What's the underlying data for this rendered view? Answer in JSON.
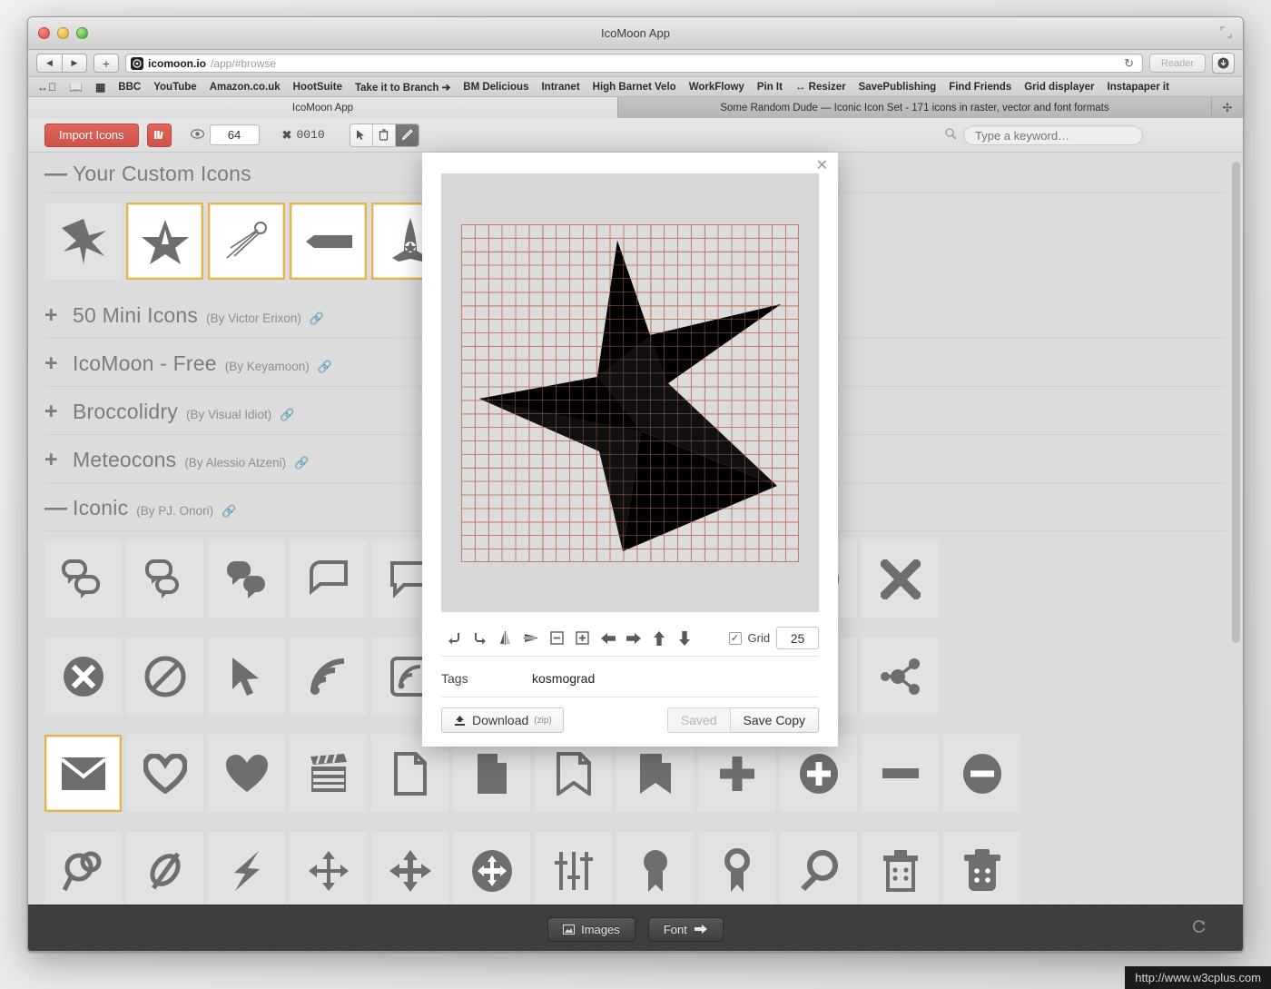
{
  "window": {
    "title": "IcoMoon App",
    "traffic_lights": [
      "close",
      "minimize",
      "zoom"
    ]
  },
  "browser": {
    "back_icon": "◀",
    "forward_icon": "▶",
    "new_tab_icon": "+",
    "site_badge_icon": "◎",
    "url_host": "icomoon.io",
    "url_path": "/app/#browse",
    "reload_icon": "↻",
    "reader_label": "Reader",
    "download_icon": "⬇",
    "bookmark_icons": [
      "glasses-icon",
      "book-icon",
      "grid-icon"
    ],
    "bookmarks": [
      "BBC",
      "YouTube",
      "Amazon.co.uk",
      "HootSuite",
      "Take it to Branch ➔",
      "BM Delicious",
      "Intranet",
      "High Barnet Velo",
      "WorkFlowy",
      "Pin It",
      "↔ Resizer",
      "SavePublishing",
      "Find Friends",
      "Grid displayer",
      "Instapaper it"
    ],
    "tabs": [
      {
        "label": "IcoMoon App",
        "active": true
      },
      {
        "label": "Some Random Dude — Iconic Icon Set - 171 icons in raster, vector and font formats",
        "active": false
      }
    ],
    "new_tab_button": "✢"
  },
  "app_toolbar": {
    "import_label": "Import Icons",
    "library_icon": "library-icon",
    "eye_icon": "◉",
    "size_value": "64",
    "x_icon": "✖",
    "x_count": "0010",
    "tools": [
      {
        "name": "select-tool",
        "icon": "➤",
        "active": false
      },
      {
        "name": "delete-tool",
        "icon": "🗑",
        "active": false
      },
      {
        "name": "edit-tool",
        "icon": "✎",
        "active": true
      }
    ],
    "search_placeholder": "Type a keyword…",
    "search_value": ""
  },
  "sets": [
    {
      "toggle": "—",
      "name": "Your Custom Icons",
      "author": "",
      "link": ""
    },
    {
      "toggle": "+",
      "name": "50 Mini Icons",
      "author": "(By Victor Erixon)",
      "link": "🔗"
    },
    {
      "toggle": "+",
      "name": "IcoMoon - Free",
      "author": "(By Keyamoon)",
      "link": "🔗"
    },
    {
      "toggle": "+",
      "name": "Broccolidry",
      "author": "(By Visual Idiot)",
      "link": "🔗"
    },
    {
      "toggle": "+",
      "name": "Meteocons",
      "author": "(By Alessio Atzeni)",
      "link": "🔗"
    },
    {
      "toggle": "—",
      "name": "Iconic",
      "author": "(By PJ. Onori)",
      "link": "🔗"
    }
  ],
  "custom_icons": [
    {
      "name": "star-burst-icon",
      "selected": false
    },
    {
      "name": "star-kosmograd-icon",
      "selected": true
    },
    {
      "name": "sputnik-icon",
      "selected": true
    },
    {
      "name": "banner-icon",
      "selected": true
    },
    {
      "name": "space-shuttle-icon",
      "selected": true
    },
    {
      "name": "icosahedron-icon",
      "selected": true
    }
  ],
  "iconic_rows": [
    [
      {
        "name": "chat-bubbles-outline-icon",
        "selected": false
      },
      {
        "name": "chat-bubbles-mixed-icon",
        "selected": false
      },
      {
        "name": "chat-bubbles-filled-icon",
        "selected": false
      },
      {
        "name": "chat-bubble-outline-icon",
        "selected": false
      },
      {
        "name": "chat-bubble-square-icon",
        "selected": false
      },
      {
        "name": "chat-bubble-round-icon",
        "selected": false
      },
      {
        "name": "comment-icon",
        "selected": false
      },
      {
        "name": "speech-bubble-icon",
        "selected": false
      },
      {
        "name": "check-icon",
        "selected": false
      },
      {
        "name": "check-circle-icon",
        "selected": false
      },
      {
        "name": "close-x-icon",
        "selected": false
      }
    ],
    [
      {
        "name": "x-circle-icon",
        "selected": false
      },
      {
        "name": "ban-icon",
        "selected": false
      },
      {
        "name": "cursor-icon",
        "selected": false
      },
      {
        "name": "rss-icon",
        "selected": false
      },
      {
        "name": "rss-square-icon",
        "selected": false
      },
      {
        "name": "article-icon",
        "selected": false
      },
      {
        "name": "layout-icon",
        "selected": false
      },
      {
        "name": "list-icon",
        "selected": false
      },
      {
        "name": "calendar-outline-icon",
        "selected": false
      },
      {
        "name": "calendar-filled-icon",
        "selected": false
      },
      {
        "name": "share-icon",
        "selected": false
      }
    ],
    [
      {
        "name": "envelope-icon",
        "selected": true
      },
      {
        "name": "heart-outline-icon",
        "selected": false
      },
      {
        "name": "heart-filled-icon",
        "selected": false
      },
      {
        "name": "clapperboard-icon",
        "selected": false
      },
      {
        "name": "file-outline-icon",
        "selected": false
      },
      {
        "name": "file-filled-icon",
        "selected": false
      },
      {
        "name": "bookmark-outline-icon",
        "selected": false
      },
      {
        "name": "bookmark-filled-icon",
        "selected": false
      },
      {
        "name": "plus-icon",
        "selected": false
      },
      {
        "name": "plus-circle-icon",
        "selected": false
      },
      {
        "name": "minus-icon",
        "selected": false
      },
      {
        "name": "minus-circle-icon",
        "selected": false
      }
    ],
    [
      {
        "name": "link-icon",
        "selected": false
      },
      {
        "name": "unlink-icon",
        "selected": false
      },
      {
        "name": "bolt-icon",
        "selected": false
      },
      {
        "name": "move-arrows-icon",
        "selected": false
      },
      {
        "name": "move-arrows-alt-icon",
        "selected": false
      },
      {
        "name": "move-circle-icon",
        "selected": false
      },
      {
        "name": "sliders-icon",
        "selected": false
      },
      {
        "name": "award-filled-icon",
        "selected": false
      },
      {
        "name": "award-outline-icon",
        "selected": false
      },
      {
        "name": "magnifier-icon",
        "selected": false
      },
      {
        "name": "trash-outline-icon",
        "selected": false
      },
      {
        "name": "trash-filled-icon",
        "selected": false
      }
    ]
  ],
  "modal": {
    "close_icon": "✕",
    "prev_arrow": "‹",
    "next_arrow": "›",
    "tools": [
      {
        "name": "rotate-left-tool",
        "icon": "↰"
      },
      {
        "name": "rotate-right-tool",
        "icon": "↱"
      },
      {
        "name": "flip-horizontal-tool",
        "icon": "▲"
      },
      {
        "name": "flip-vertical-tool",
        "icon": "◀"
      },
      {
        "name": "scale-down-tool",
        "icon": "⊟"
      },
      {
        "name": "scale-up-tool",
        "icon": "⊞"
      },
      {
        "name": "move-left-tool",
        "icon": "←"
      },
      {
        "name": "move-right-tool",
        "icon": "→"
      },
      {
        "name": "move-up-tool",
        "icon": "↑"
      },
      {
        "name": "move-down-tool",
        "icon": "↓"
      }
    ],
    "grid_checked": true,
    "grid_check_icon": "✓",
    "grid_label": "Grid",
    "grid_value": "25",
    "tags_label": "Tags",
    "tags_value": "kosmograd",
    "download_icon": "⤒",
    "download_label": "Download",
    "download_sub": "(zip)",
    "saved_label": "Saved",
    "save_copy_label": "Save Copy"
  },
  "bottom_bar": {
    "images_icon": "❐",
    "images_label": "Images",
    "font_label": "Font",
    "font_arrow": "➔",
    "refresh_icon": "↻"
  },
  "watermark": "http://www.w3cplus.com",
  "colors": {
    "accent_red": "#cf5247",
    "selection_gold": "#e3b44d",
    "grid_line": "#c87b6e",
    "icon_gray": "#6e6e6e",
    "bottom_bar": "#3c3c3c"
  }
}
